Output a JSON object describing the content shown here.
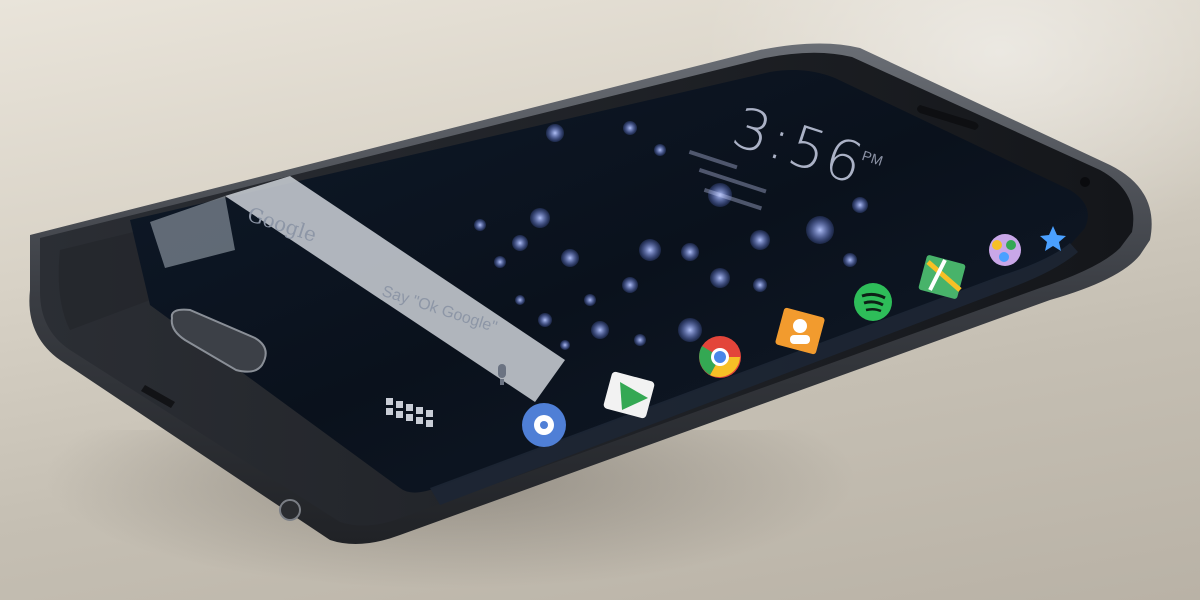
{
  "scene": {
    "lockscreen": {
      "clock": "3:56",
      "clock_suffix": "PM"
    },
    "google_bar": {
      "brand": "Google",
      "hint": "Say \"Ok Google\""
    },
    "edge_apps": [
      {
        "name": "settings-icon",
        "color": "#4f7fd6"
      },
      {
        "name": "play-store-icon",
        "color": "#f2f2f2"
      },
      {
        "name": "chrome-icon",
        "color": "#e3453a"
      },
      {
        "name": "contacts-icon",
        "color": "#f29b2e"
      },
      {
        "name": "spotify-icon",
        "color": "#2ebd59"
      },
      {
        "name": "maps-icon",
        "color": "#48b36a"
      },
      {
        "name": "gallery-icon",
        "color": "#c9a7e8"
      },
      {
        "name": "star-icon",
        "color": "#4aa0ff"
      }
    ],
    "colors": {
      "screen": "#0c1420",
      "bokeh": "#8ea6ff",
      "bezel": "#1a1c20",
      "frame": "#5b5f66"
    }
  }
}
